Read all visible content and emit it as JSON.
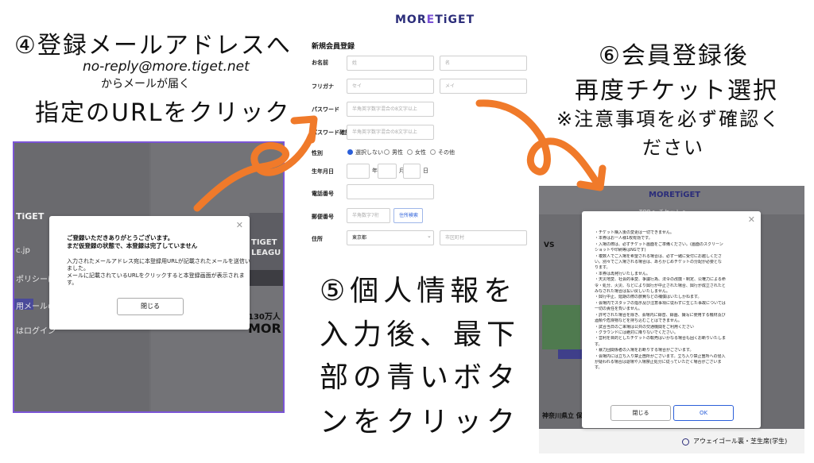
{
  "annotations": {
    "step4_title": "④登録メールアドレスへ",
    "step4_email": "no-reply@more.tiget.net",
    "step4_sub": "からメールが届く",
    "step4_action": "指定のURLをクリック",
    "step6_line1": "⑥会員登録後",
    "step6_line2": "再度チケット選択",
    "step6_line3": "※注意事項を必ず確認く",
    "step6_line4": "ださい",
    "step5_line1": "⑤個人情報を",
    "step5_line2": "入力後、最下",
    "step5_line3": "部の青いボタ",
    "step5_line4": "ンをクリック"
  },
  "left_screen": {
    "logo": "TiGET",
    "side_items": [
      "c.jp",
      "ポリシーに同意",
      "用メールの送信",
      "はログイン"
    ],
    "right_texts": [
      "TIGET",
      "LEAGU",
      "130万人",
      "MOR"
    ],
    "modal": {
      "line1": "ご登録いただきありがとうございます。",
      "line2": "まだ仮登録の状態で、本登録は完了していません",
      "body1": "入力されたメールアドレス宛に本登録用URLが記載されたメールを送信い",
      "body2": "ました。",
      "body3": "メールに記載されているURLをクリックすると本登録画面が表示されま",
      "body4": "す。",
      "close_button": "閉じる"
    }
  },
  "form": {
    "logo_main": "MORETiGET",
    "title": "新規会員登録",
    "name_label": "お名前",
    "last_name_ph": "姓",
    "first_name_ph": "名",
    "kana_label": "フリガナ",
    "last_kana_ph": "セイ",
    "first_kana_ph": "メイ",
    "password_label": "パスワード",
    "password_ph": "半角英字数字混合の8文字以上",
    "password_confirm_label": "パスワード確認",
    "password_confirm_ph": "半角英字数字混合の8文字以上",
    "gender_label": "性別",
    "gender_options": [
      "選択しない",
      "男性",
      "女性",
      "その他"
    ],
    "birth_label": "生年月日",
    "year": "年",
    "month": "月",
    "day": "日",
    "phone_label": "電話番号",
    "zip_label": "郵便番号",
    "zip_ph": "半角数字7桁",
    "zip_search": "住所検索",
    "address_label": "住所",
    "prefecture": "東京都",
    "city_ph": "市区町村"
  },
  "right_screen": {
    "logo": "MORETiGET",
    "breadcrumb": "TOP > チケット > ...",
    "vs": "VS",
    "team_label": "神奈川県立 保土",
    "bottom_option": "アウェイゴール裏・芝生席(学生)",
    "modal": {
      "lines": [
        "・チケット購入後の変更は一切できません。",
        "・本券はお一人様1枚有効です。",
        "・入場の際は、必ずチケット画面をご準備ください。(画面のスクリーン",
        "  ショットや印刷等はNGです)",
        "・複数人でご入場を希望される場合は、必ず一緒に受付にお越しくださ",
        "  い。別々でご入場される場合は、あらかじめチケットの分配が必要とな",
        "  ります。",
        "・本券は再発行いたしません。",
        "・天災地変、社会的事変、争議行為、法令の改廃・制定、公権力による命",
        "  令・処分、火災、などにより興行が中止された場合、興行が成立されたと",
        "  みなされた場合は払い戻しいたしません。",
        "・興行中止、延期の際の旅費などの補償はいたしかねます。",
        "・会場内でスタッフの指示及び注意事項に従わずに生じた事故については",
        "  一切の責任を負いません。",
        "・許可された場合を除き、会場内に録音、録画、撮写に使用する機材及び",
        "  酒類や危険物などを持ち込むことはできません。",
        "・試合当日のご来場は公共の交通機関をご利用ください",
        "・グラウンドには絶対に降りないでください。",
        "・営利を目的としたチケットの転売はいかなる場合も固くお断りいたしま",
        "  す。",
        "・暴力団関係者の入場をお断りする場合がございます。",
        "・会場内には立ち入り禁止箇所がございます。立ち入り禁止箇所への侵入",
        "  が疑われる場合は退場や入場禁止処分に従っていただく場合がございま",
        "  す。"
      ],
      "close_button": "閉じる",
      "ok_button": "OK"
    }
  },
  "colors": {
    "arrow": "#f07a2a",
    "brand": "#2b2d7a",
    "primary_blue": "#2b5fd9",
    "panel_border": "#7b55d6"
  }
}
